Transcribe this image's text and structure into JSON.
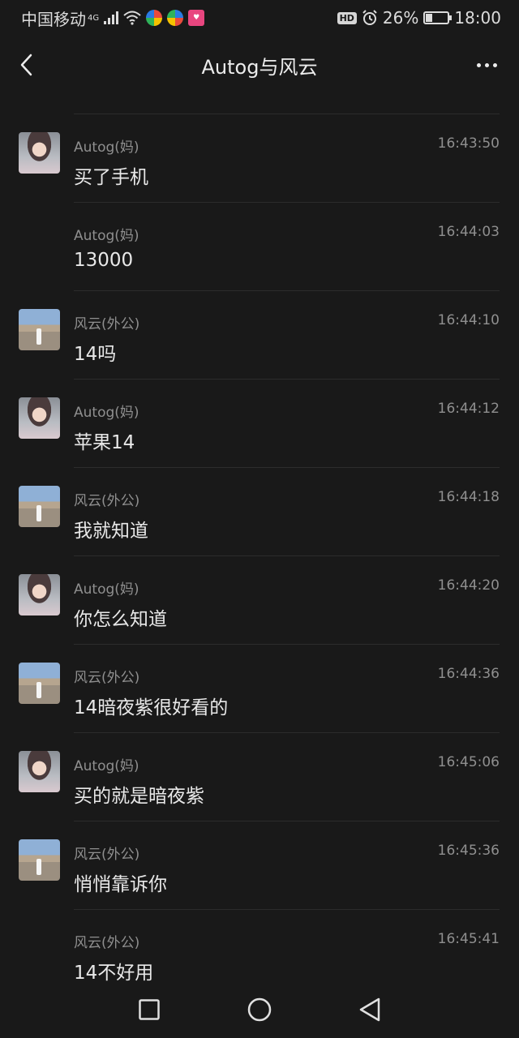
{
  "status_bar": {
    "carrier": "中国移动",
    "network": "4G",
    "hd": "HD",
    "battery": "26%",
    "time": "18:00"
  },
  "header": {
    "title": "Autog与风云"
  },
  "messages": [
    {
      "sender": "Autog(妈)",
      "time": "16:43:50",
      "text": "买了手机",
      "avatar": "mom"
    },
    {
      "sender": "Autog(妈)",
      "time": "16:44:03",
      "text": "13000",
      "avatar": ""
    },
    {
      "sender": "风云(外公)",
      "time": "16:44:10",
      "text": "14吗",
      "avatar": "dad"
    },
    {
      "sender": "Autog(妈)",
      "time": "16:44:12",
      "text": "苹果14",
      "avatar": "mom"
    },
    {
      "sender": "风云(外公)",
      "time": "16:44:18",
      "text": "我就知道",
      "avatar": "dad"
    },
    {
      "sender": "Autog(妈)",
      "time": "16:44:20",
      "text": "你怎么知道",
      "avatar": "mom"
    },
    {
      "sender": "风云(外公)",
      "time": "16:44:36",
      "text": "14暗夜紫很好看的",
      "avatar": "dad"
    },
    {
      "sender": "Autog(妈)",
      "time": "16:45:06",
      "text": "买的就是暗夜紫",
      "avatar": "mom"
    },
    {
      "sender": "风云(外公)",
      "time": "16:45:36",
      "text": "悄悄靠诉你",
      "avatar": "dad"
    },
    {
      "sender": "风云(外公)",
      "time": "16:45:41",
      "text": "14不好用",
      "avatar": ""
    }
  ]
}
